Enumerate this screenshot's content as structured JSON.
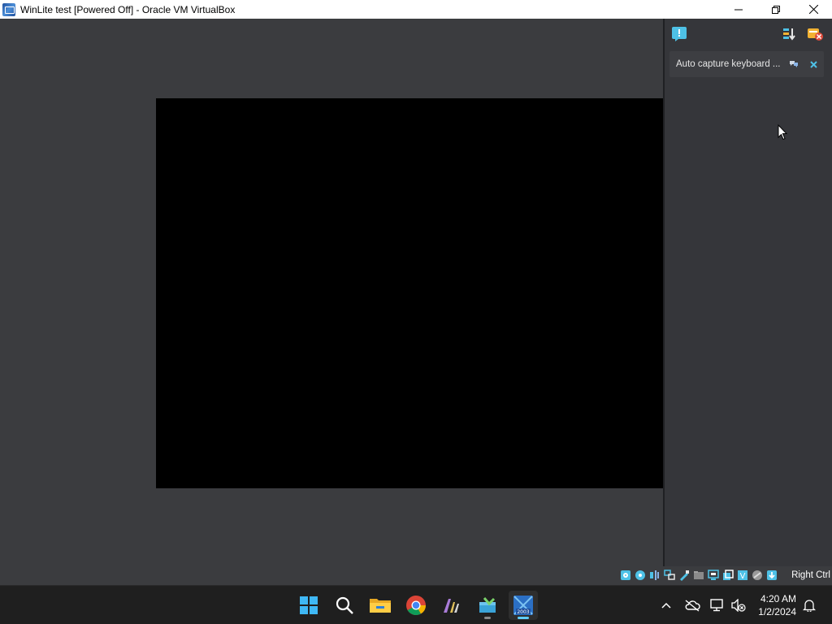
{
  "window": {
    "title": "WinLite test [Powered Off] - Oracle VM VirtualBox",
    "icon": "virtualbox-icon",
    "controls": [
      "minimize-icon",
      "maximize-icon",
      "close-icon"
    ]
  },
  "notification_center": {
    "toolbar_icons": [
      "message-icon",
      "sort-icon",
      "clear-all-icon"
    ],
    "notices": [
      {
        "text": "Auto capture keyboard ...",
        "actions": [
          "toggle-icon",
          "close-icon"
        ]
      }
    ]
  },
  "statusbar": {
    "icons": [
      "hard-disk-icon",
      "optical-drive-icon",
      "audio-icon",
      "network-icon",
      "usb-icon",
      "shared-folders-icon",
      "display-icon",
      "recording-icon",
      "cpu-icon",
      "mouse-integration-icon",
      "keyboard-icon"
    ],
    "host_key": "Right Ctrl"
  },
  "taskbar": {
    "apps": [
      {
        "name": "start-button",
        "icon": "windows-icon"
      },
      {
        "name": "search-button",
        "icon": "search-icon"
      },
      {
        "name": "file-explorer",
        "icon": "folder-icon"
      },
      {
        "name": "chrome",
        "icon": "chrome-icon"
      },
      {
        "name": "app-pen",
        "icon": "pen-icon"
      },
      {
        "name": "app-installer",
        "icon": "installer-icon"
      },
      {
        "name": "virtualbox",
        "icon": "virtualbox-icon",
        "badge": "2003"
      }
    ],
    "clock_time": "4:20 AM",
    "clock_date": "1/2/2024"
  },
  "colors": {
    "accent": "#60cdff",
    "vm_background": "#3b3c3f",
    "taskbar": "#1f1f1f"
  }
}
